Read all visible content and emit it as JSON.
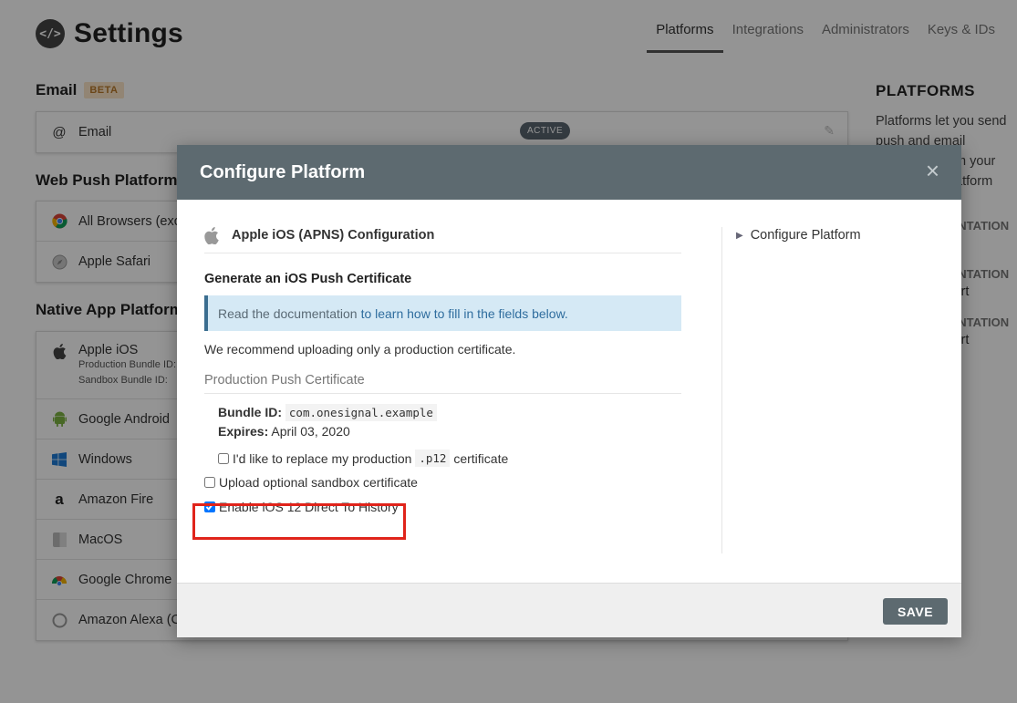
{
  "header": {
    "logo_glyph": "</>",
    "title": "Settings"
  },
  "nav": {
    "tabs": [
      "Platforms",
      "Integrations",
      "Administrators",
      "Keys & IDs"
    ],
    "active": "Platforms"
  },
  "email_section": {
    "title": "Email",
    "badge": "BETA",
    "row_label": "Email",
    "status": "ACTIVE"
  },
  "web_push": {
    "title": "Web Push Platforms",
    "rows": [
      "All Browsers (excluding Safari)",
      "Apple Safari"
    ]
  },
  "native_app": {
    "title": "Native App Platforms",
    "ios": {
      "label": "Apple iOS",
      "prod_bundle": "Production Bundle ID:",
      "sandbox_bundle": "Sandbox Bundle ID:"
    },
    "rows": [
      "Google Android",
      "Windows",
      "Amazon Fire",
      "MacOS",
      "Google Chrome",
      "Amazon Alexa (Coming Soon)"
    ]
  },
  "right_column": {
    "title": "PLATFORMS",
    "text": "Platforms let you send push and email messages from your app. Pick a platform",
    "doc_heading": "OUR DOCUMENTATION",
    "doc_links": [
      "Quickstart",
      "Push Quickstart",
      "Push Quickstart"
    ]
  },
  "modal": {
    "title": "Configure Platform",
    "close": "×",
    "apns_title": "Apple iOS (APNS) Configuration",
    "generate_title": "Generate an iOS Push Certificate",
    "info_text": "Read the documentation",
    "info_link": "to learn how to fill in the fields below.",
    "recommend": "We recommend uploading only a production certificate.",
    "prod_cert_title": "Production Push Certificate",
    "bundle_label": "Bundle ID:",
    "bundle_value": "com.onesignal.example",
    "expires_label": "Expires:",
    "expires_value": "April 03, 2020",
    "replace_pre": "I'd like to replace my production",
    "replace_code": ".p12",
    "replace_post": "certificate",
    "sandbox_label": "Upload optional sandbox certificate",
    "ios12_label": "Enable iOS 12 Direct To History",
    "toc_item": "Configure Platform",
    "save": "SAVE"
  },
  "colors": {
    "modal_header": "#5d6a70",
    "highlight": "#e0241b",
    "info_bg": "#d5e9f5",
    "info_border": "#3b6e90"
  }
}
